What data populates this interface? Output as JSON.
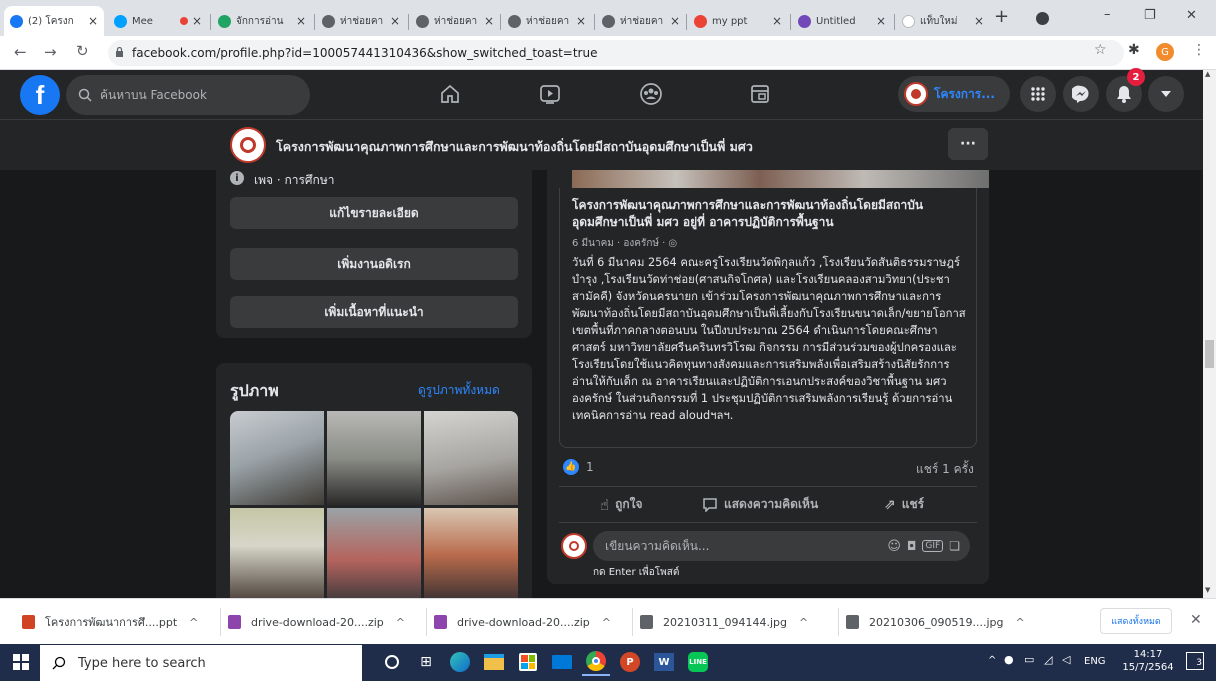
{
  "browser": {
    "tabs": [
      {
        "title": "(2) โครงก",
        "fav": "#1877f2",
        "active": true
      },
      {
        "title": "Mee",
        "fav": "#00a0ff",
        "extra": "rec"
      },
      {
        "title": "จักการอ่าน",
        "fav": "#1fa463"
      },
      {
        "title": "ห่าช่อยคา",
        "fav": "#5f6368"
      },
      {
        "title": "ห่าช่อยคา",
        "fav": "#5f6368"
      },
      {
        "title": "ห่าช่อยคา",
        "fav": "#5f6368"
      },
      {
        "title": "ห่าช่อยคา",
        "fav": "#5f6368"
      },
      {
        "title": "my ppt",
        "fav": "#ea4335"
      },
      {
        "title": "Untitled",
        "fav": "#7248b9"
      },
      {
        "title": "แท็บใหม่",
        "fav": "#ffffff"
      }
    ],
    "new_tab": "+",
    "url": "facebook.com/profile.php?id=100057441310436&show_switched_toast=true",
    "window_controls": {
      "minimize": "–",
      "restore": "❐",
      "close": "✕"
    },
    "profile_initial": "G"
  },
  "fb": {
    "search_placeholder": "ค้นหาบน Facebook",
    "page_switch_label": "โครงการ...",
    "notif_count": "2",
    "page_name": "โครงการพัฒนาคุณภาพการศึกษาและการพัฒนาท้องถิ่นโดยมีสถาบันอุดมศึกษาเป็นพี่ มศว",
    "more_dots": "···",
    "sidebar": {
      "category": "เพจ · การศึกษา",
      "edit_details": "แก้ไขรายละเอียด",
      "add_link": "เพิ่มงานอดิเรก",
      "add_featured": "เพิ่มเนื้อหาที่แนะนำ",
      "photos_title": "รูปภาพ",
      "see_all_photos": "ดูรูปภาพทั้งหมด"
    },
    "post": {
      "title": "โครงการพัฒนาคุณภาพการศึกษาและการพัฒนาท้องถิ่นโดยมีสถาบันอุดมศึกษาเป็นพี่ มศว อยู่ที่ อาคารปฏิบัติการพื้นฐาน",
      "meta": "6 มีนาคม · องครักษ์ ·",
      "body": "วันที่ 6 มีนาคม 2564 คณะครูโรงเรียนวัดพิกุลแก้ว ,โรงเรียนวัดสันติธรรมราษฎร์บำรุง ,โรงเรียนวัดท่าช่อย(ศาสนกิจโกศล) และโรงเรียนคลองสามวิทยา(ประชาสามัคคี) จังหวัดนครนายก เข้าร่วมโครงการพัฒนาคุณภาพการศึกษาและการพัฒนาท้องถิ่นโดยมีสถาบันอุดมศึกษาเป็นพี่เลี้ยงกับโรงเรียนขนาดเล็ก/ขยายโอกาส เขตพื้นที่ภาคกลางตอนบน ในปีงบประมาณ 2564 ดำเนินการโดยคณะศึกษาศาสตร์ มหาวิทยาลัยศรีนครินทรวิโรฒ กิจกรรม การมีส่วนร่วมของผู้ปกครองและโรงเรียนโดยใช้แนวคิดทุนทางสังคมและการเสริมพลังเพื่อเสริมสร้างนิสัยรักการอ่านให้กับเด็ก ณ อาคารเรียนและปฏิบัติการเอนกประสงค์ของวิชาพื้นฐาน มศว องครักษ์ ในส่วนกิจกรรมที่ 1 ประชุมปฏิบัติการเสริมพลังการเรียนรู้ ด้วยการอ่าน เทคนิคการอ่าน read aloudฯลฯ.",
      "likes": "1",
      "shares": "แชร์ 1 ครั้ง",
      "like_btn": "ถูกใจ",
      "comment_btn": "แสดงความคิดเห็น",
      "share_btn": "แชร์",
      "comment_placeholder": "เขียนความคิดเห็น...",
      "enter_hint": "กด Enter เพื่อโพสต์"
    }
  },
  "downloads": {
    "items": [
      {
        "name": "โครงการพัฒนาการศึ....ppt",
        "color": "#d04423"
      },
      {
        "name": "drive-download-20....zip",
        "color": "#8e44ad"
      },
      {
        "name": "drive-download-20....zip",
        "color": "#8e44ad"
      },
      {
        "name": "20210311_094144.jpg",
        "color": "#5f6368"
      },
      {
        "name": "20210306_090519....jpg",
        "color": "#5f6368"
      }
    ],
    "show_all": "แสดงทั้งหมด"
  },
  "taskbar": {
    "search_placeholder": "Type here to search",
    "lang": "ENG",
    "time": "14:17",
    "date": "15/7/2564",
    "notif": "3"
  }
}
